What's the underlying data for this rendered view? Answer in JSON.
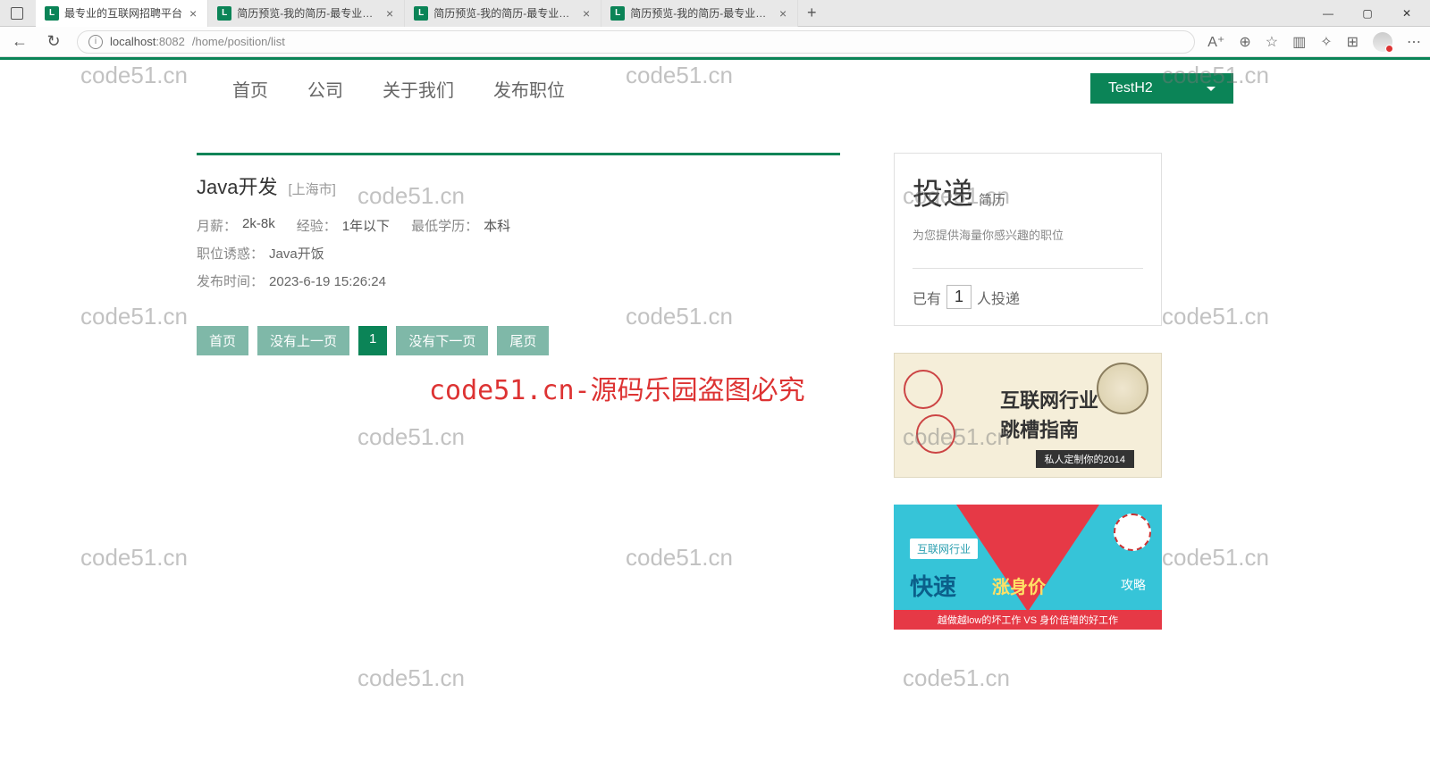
{
  "browser": {
    "tabs": [
      {
        "title": "最专业的互联网招聘平台",
        "active": true
      },
      {
        "title": "简历预览-我的简历-最专业的互",
        "active": false
      },
      {
        "title": "简历预览-我的简历-最专业的互",
        "active": false
      },
      {
        "title": "简历预览-我的简历-最专业的互",
        "active": false
      }
    ],
    "favicon_letter": "L",
    "url_host": "localhost",
    "url_port": ":8082",
    "url_path": "/home/position/list"
  },
  "nav": {
    "home": "首页",
    "company": "公司",
    "about": "关于我们",
    "publish": "发布职位"
  },
  "user_menu": "TestH2",
  "job": {
    "title": "Java开发",
    "location": "[上海市]",
    "salary_label": "月薪：",
    "salary_value": "2k-8k",
    "exp_label": "经验：",
    "exp_value": "1年以下",
    "edu_label": "最低学历：",
    "edu_value": "本科",
    "perk_label": "职位诱惑：",
    "perk_value": "Java开饭",
    "time_label": "发布时间：",
    "time_value": "2023-6-19 15:26:24"
  },
  "pagination": {
    "first": "首页",
    "prev": "没有上一页",
    "current": "1",
    "next": "没有下一页",
    "last": "尾页"
  },
  "panel": {
    "big": "投递",
    "small": "简历",
    "sub": "为您提供海量你感兴趣的职位",
    "count_prefix": "已有",
    "count_value": "1",
    "count_suffix": "人投递"
  },
  "ad1": {
    "line1": "互联网行业",
    "line2": "跳槽指南",
    "bar": "私人定制你的2014"
  },
  "ad2": {
    "tag": "互联网行业",
    "t1": "快速",
    "t2": "涨身价",
    "t3": "攻略",
    "bar": "越做越low的坏工作 VS 身价倍增的好工作"
  },
  "watermark_text": "code51.cn",
  "watermark_red": "code51.cn-源码乐园盗图必究"
}
